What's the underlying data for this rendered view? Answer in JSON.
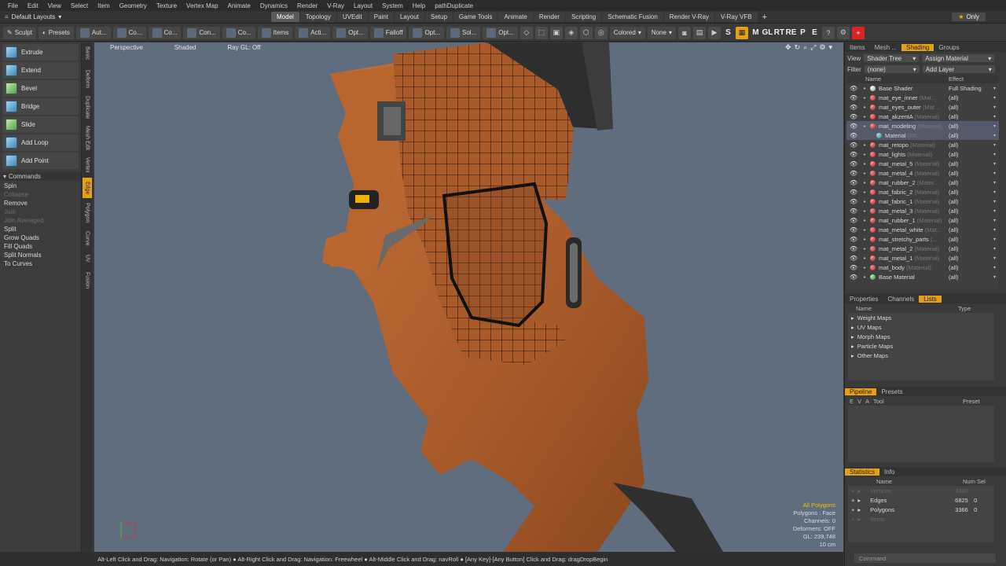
{
  "menu": [
    "File",
    "Edit",
    "View",
    "Select",
    "Item",
    "Geometry",
    "Texture",
    "Vertex Map",
    "Animate",
    "Dynamics",
    "Render",
    "V-Ray",
    "Layout",
    "System",
    "Help",
    "pathDuplicate"
  ],
  "layout_selector": "Default Layouts",
  "layout_tabs": [
    {
      "label": "Model",
      "active": true
    },
    {
      "label": "Topology",
      "active": false
    },
    {
      "label": "UVEdit",
      "active": false
    },
    {
      "label": "Paint",
      "active": false
    },
    {
      "label": "Layout",
      "active": false
    },
    {
      "label": "Setup",
      "active": false
    },
    {
      "label": "Game Tools",
      "active": false
    },
    {
      "label": "Animate",
      "active": false
    },
    {
      "label": "Render",
      "active": false
    },
    {
      "label": "Scripting",
      "active": false
    },
    {
      "label": "Schematic Fusion",
      "active": false
    },
    {
      "label": "Render V-Ray",
      "active": false
    },
    {
      "label": "V-Ray VFB",
      "active": false
    }
  ],
  "only_label": "Only",
  "toolbar": {
    "sculpt": "Sculpt",
    "presets": "Presets",
    "buttons": [
      "Aut...",
      "Co...",
      "Co...",
      "Con...",
      "Co...",
      "Items",
      "Acti...",
      "Opt...",
      "Falloff",
      "Opt...",
      "Sol...",
      "Opt..."
    ],
    "colored": "Colored",
    "none": "None",
    "letters": [
      "M",
      "GL",
      "RT",
      "RE",
      "P",
      "E"
    ]
  },
  "tools": [
    "Extrude",
    "Extend",
    "Bevel",
    "Bridge",
    "Slide",
    "Add Loop",
    "Add Point"
  ],
  "commands_header": "Commands",
  "commands": [
    {
      "label": "Spin",
      "enabled": true
    },
    {
      "label": "Collapse",
      "enabled": false
    },
    {
      "label": "Remove",
      "enabled": true
    },
    {
      "label": "Join",
      "enabled": false
    },
    {
      "label": "Join Averaged",
      "enabled": false
    },
    {
      "label": "Split",
      "enabled": true
    },
    {
      "label": "Grow Quads",
      "enabled": true
    },
    {
      "label": "Fill Quads",
      "enabled": true
    },
    {
      "label": "Split Normals",
      "enabled": true
    },
    {
      "label": "To Curves",
      "enabled": true
    }
  ],
  "vertical_tabs": [
    "Basic",
    "Deform",
    "Duplicate",
    "Mesh Edit",
    "Vertex",
    "Edge",
    "Polygon",
    "Curve",
    "UV",
    "Fusion"
  ],
  "viewport": {
    "view": "Perspective",
    "shading": "Shaded",
    "raygl": "Ray GL: Off",
    "stats": {
      "all_polygons": "All Polygons",
      "polygons_line": "Polygons : Face",
      "channels_line": "Channels: 0",
      "deformers_line": "Deformers: OFF",
      "gl_line": "GL: 239,748",
      "scale_line": "10 cm"
    }
  },
  "status_text": "Alt-Left Click and Drag: Navigation: Rotate (or Pan) ● Alt-Right Click and Drag: Navigation: Freewheel ● Alt-Middle Click and Drag: navRoll ● [Any Key]-[Any Button] Click and Drag: dragDropBegin",
  "shader_panel": {
    "tabs": [
      {
        "label": "Items",
        "active": false
      },
      {
        "label": "Mesh ...",
        "active": false
      },
      {
        "label": "Shading",
        "active": true
      },
      {
        "label": "Groups",
        "active": false
      }
    ],
    "view_label": "View",
    "view_value": "Shader Tree",
    "assign_material": "Assign Material",
    "filter_label": "Filter",
    "filter_value": "(none)",
    "add_layer": "Add Layer",
    "col_name": "Name",
    "col_effect": "Effect",
    "rows": [
      {
        "name": "Base Shader",
        "type": "",
        "effect": "Full Shading",
        "ball": "white",
        "selected": false,
        "indent": 0
      },
      {
        "name": "mat_eye_inner",
        "type": "(Mat...",
        "effect": "(all)",
        "ball": "red",
        "selected": false,
        "indent": 0
      },
      {
        "name": "mat_eyes_outer",
        "type": "(Mat...",
        "effect": "(all)",
        "ball": "red",
        "selected": false,
        "indent": 0
      },
      {
        "name": "mat_akzentA",
        "type": "(Material)",
        "effect": "(all)",
        "ball": "red",
        "selected": false,
        "indent": 0
      },
      {
        "name": "mat_modeling",
        "type": "(Material)",
        "effect": "(all)",
        "ball": "red",
        "selected": true,
        "indent": 0
      },
      {
        "name": "Material",
        "type": "(Sh...",
        "effect": "(all)",
        "ball": "blue",
        "selected": true,
        "indent": 1
      },
      {
        "name": "mat_retopo",
        "type": "(Material)",
        "effect": "(all)",
        "ball": "red",
        "selected": false,
        "indent": 0
      },
      {
        "name": "mat_lights",
        "type": "(Material)",
        "effect": "(all)",
        "ball": "red",
        "selected": false,
        "indent": 0
      },
      {
        "name": "mat_metal_5",
        "type": "(Material)",
        "effect": "(all)",
        "ball": "red",
        "selected": false,
        "indent": 0
      },
      {
        "name": "mat_metal_4",
        "type": "(Material)",
        "effect": "(all)",
        "ball": "red",
        "selected": false,
        "indent": 0
      },
      {
        "name": "mat_rubber_2",
        "type": "(Mater...",
        "effect": "(all)",
        "ball": "red",
        "selected": false,
        "indent": 0
      },
      {
        "name": "mat_fabric_2",
        "type": "(Material)",
        "effect": "(all)",
        "ball": "red",
        "selected": false,
        "indent": 0
      },
      {
        "name": "mat_fabric_1",
        "type": "(Material)",
        "effect": "(all)",
        "ball": "red",
        "selected": false,
        "indent": 0
      },
      {
        "name": "mat_metal_3",
        "type": "(Material)",
        "effect": "(all)",
        "ball": "red",
        "selected": false,
        "indent": 0
      },
      {
        "name": "mat_rubber_1",
        "type": "(Material)",
        "effect": "(all)",
        "ball": "red",
        "selected": false,
        "indent": 0
      },
      {
        "name": "mat_metal_white",
        "type": "(Mat...",
        "effect": "(all)",
        "ball": "red",
        "selected": false,
        "indent": 0
      },
      {
        "name": "mat_stretchy_parts",
        "type": "(...",
        "effect": "(all)",
        "ball": "red",
        "selected": false,
        "indent": 0
      },
      {
        "name": "mat_metal_2",
        "type": "(Material)",
        "effect": "(all)",
        "ball": "red",
        "selected": false,
        "indent": 0
      },
      {
        "name": "mat_metal_1",
        "type": "(Material)",
        "effect": "(all)",
        "ball": "red",
        "selected": false,
        "indent": 0
      },
      {
        "name": "mat_body",
        "type": "(Material)",
        "effect": "(all)",
        "ball": "red",
        "selected": false,
        "indent": 0
      },
      {
        "name": "Base Material",
        "type": "",
        "effect": "(all)",
        "ball": "green",
        "selected": false,
        "indent": 0
      }
    ]
  },
  "lists_panel": {
    "tabs": [
      {
        "label": "Properties",
        "active": false
      },
      {
        "label": "Channels",
        "active": false
      },
      {
        "label": "Lists",
        "active": true
      }
    ],
    "col_name": "Name",
    "col_type": "Type",
    "rows": [
      "Weight Maps",
      "UV Maps",
      "Morph Maps",
      "Particle Maps",
      "Other Maps"
    ]
  },
  "pipeline_panel": {
    "tabs": [
      {
        "label": "Pipeline",
        "active": true
      },
      {
        "label": "Presets",
        "active": false
      }
    ],
    "cols": [
      "E",
      "V",
      "A",
      "Tool",
      "Preset"
    ]
  },
  "statistics_panel": {
    "tabs": [
      {
        "label": "Statistics",
        "active": true
      },
      {
        "label": "Info",
        "active": false
      }
    ],
    "col_name": "Name",
    "col_num": "Num",
    "col_sel": "Sel",
    "rows": [
      {
        "name": "Vertices",
        "num": "3490",
        "sel": "",
        "dim": true
      },
      {
        "name": "Edges",
        "num": "6825",
        "sel": "0",
        "dim": false
      },
      {
        "name": "Polygons",
        "num": "3366",
        "sel": "0",
        "dim": false
      },
      {
        "name": "Items",
        "num": "",
        "sel": "",
        "dim": true
      }
    ]
  },
  "command_placeholder": "Command",
  "colors": {
    "accent": "#e6a013",
    "viewport_bg": "#5f6d7e",
    "mesh": "#b5622e"
  }
}
